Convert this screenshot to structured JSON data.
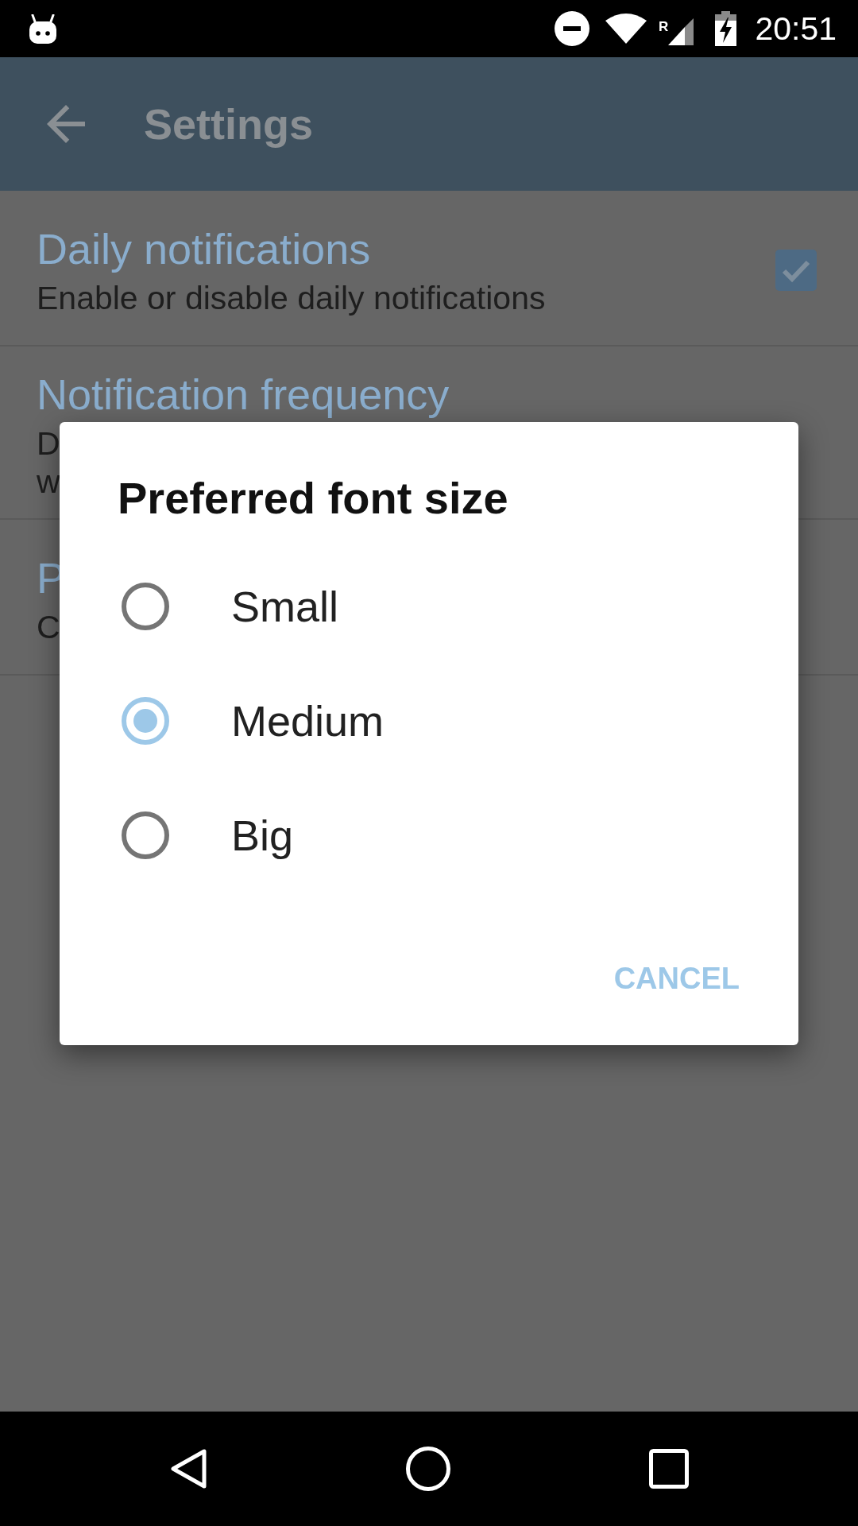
{
  "status_bar": {
    "roaming_indicator": "R",
    "time": "20:51"
  },
  "app_bar": {
    "title": "Settings"
  },
  "settings": [
    {
      "kind": "checkbox",
      "title": "Daily notifications",
      "summary": [
        "Enable or disable daily notifications"
      ],
      "checked": true
    },
    {
      "kind": "plain",
      "title": "Notification frequency",
      "summary": [
        "D",
        "w"
      ]
    },
    {
      "kind": "plain",
      "title": "P",
      "summary": [
        "C"
      ]
    }
  ],
  "dialog": {
    "title": "Preferred font size",
    "options": [
      {
        "label": "Small",
        "selected": false
      },
      {
        "label": "Medium",
        "selected": true
      },
      {
        "label": "Big",
        "selected": false
      }
    ],
    "buttons": [
      "CANCEL"
    ]
  }
}
